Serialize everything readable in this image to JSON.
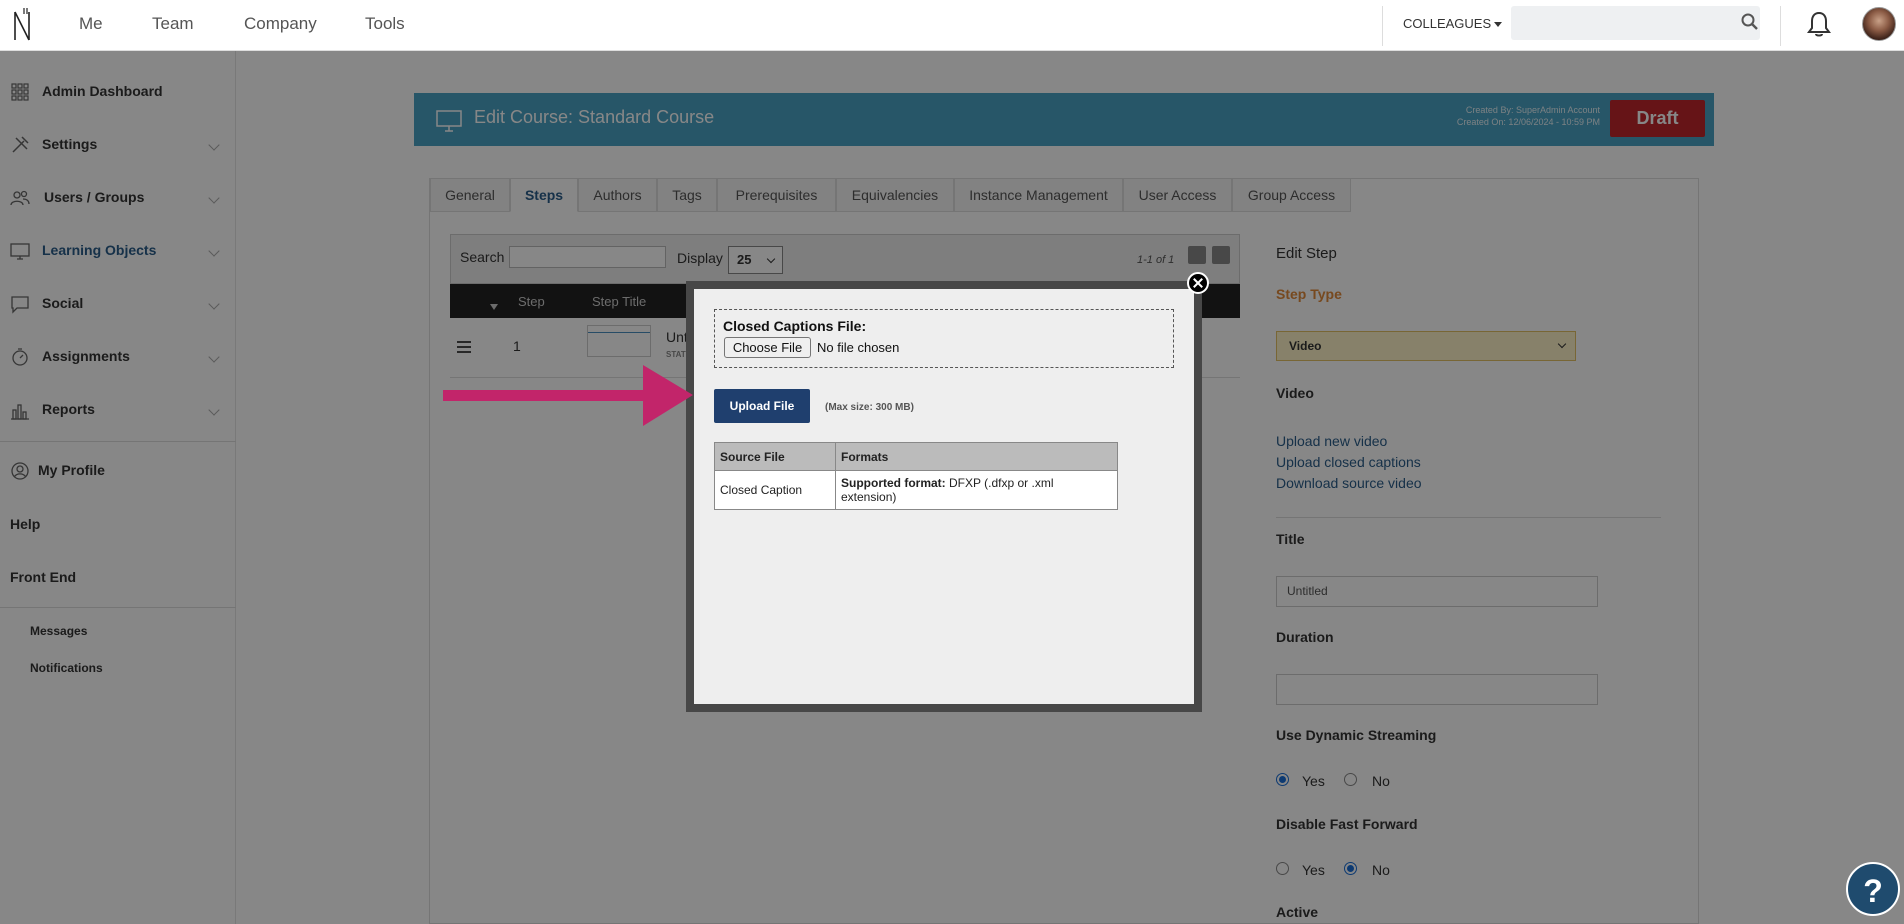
{
  "topnav": {
    "links": [
      "Me",
      "Team",
      "Company",
      "Tools"
    ],
    "colleagues_label": "COLLEAGUES",
    "search_placeholder": ""
  },
  "sidebar": {
    "items": [
      {
        "label": "Admin Dashboard",
        "icon": "dashboard-icon"
      },
      {
        "label": "Settings",
        "icon": "tools-icon"
      },
      {
        "label": "Users / Groups",
        "icon": "users-icon"
      },
      {
        "label": "Learning Objects",
        "icon": "monitor-icon"
      },
      {
        "label": "Social",
        "icon": "chat-icon"
      },
      {
        "label": "Assignments",
        "icon": "stopwatch-icon"
      },
      {
        "label": "Reports",
        "icon": "bar-chart-icon"
      },
      {
        "label": "My Profile",
        "icon": "profile-icon"
      }
    ],
    "help": "Help",
    "front_end": "Front End",
    "messages": "Messages",
    "notifications": "Notifications"
  },
  "course": {
    "title": "Edit Course: Standard Course",
    "created_by": "Created By: SuperAdmin Account",
    "created_on": "Created On: 12/06/2024 - 10:59 PM",
    "status": "Draft"
  },
  "tabs": [
    "General",
    "Steps",
    "Authors",
    "Tags",
    "Prerequisites",
    "Equivalencies",
    "Instance Management",
    "User Access",
    "Group Access"
  ],
  "steps_table": {
    "search_label": "Search",
    "display_label": "Display",
    "display_value": "25",
    "pager_text": "1-1 of 1",
    "columns": [
      "Step",
      "Step Title"
    ],
    "row": {
      "step": "1",
      "title": "Unt",
      "status": "STAT"
    }
  },
  "edit_step": {
    "title": "Edit Step",
    "step_type_label": "Step Type",
    "step_type_value": "Video",
    "video_label": "Video",
    "links": [
      "Upload new video",
      "Upload closed captions",
      "Download source video"
    ],
    "title_label": "Title",
    "title_value": "Untitled",
    "duration_label": "Duration",
    "dynamic_label": "Use Dynamic Streaming",
    "disable_ff_label": "Disable Fast Forward",
    "active_label": "Active",
    "yes": "Yes",
    "no": "No"
  },
  "modal": {
    "cc_label": "Closed Captions File:",
    "choose_file": "Choose File",
    "no_file": "No file chosen",
    "upload_button": "Upload File",
    "max_size": "(Max size: 300 MB)",
    "table": {
      "headers": [
        "Source File",
        "Formats"
      ],
      "row": {
        "source": "Closed Caption",
        "format_label": "Supported format:",
        "format_value": "DFXP (.dfxp or .xml extension)"
      }
    }
  },
  "help_button": "?",
  "colors": {
    "header_blue": "#4aa3c5",
    "draft_red": "#c0272d",
    "upload_navy": "#1f3f6e",
    "arrow_magenta": "#c2256a",
    "step_type_orange": "#e08a3c"
  }
}
